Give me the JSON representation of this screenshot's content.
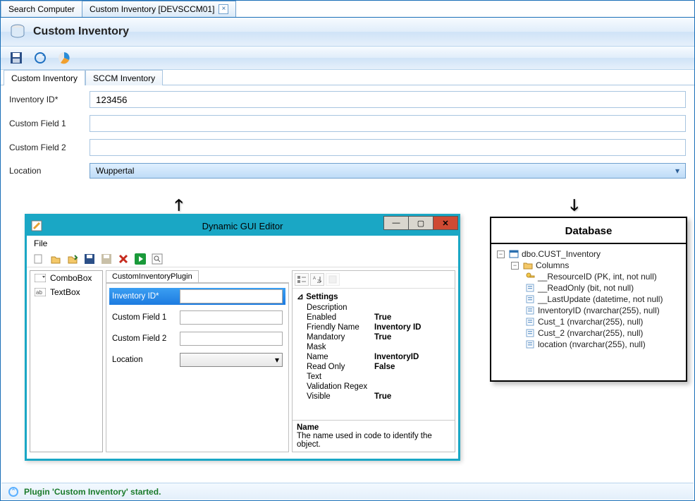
{
  "tabs": {
    "search": "Search Computer",
    "inventory": "Custom Inventory [DEVSCCM01]"
  },
  "header": {
    "title": "Custom Inventory"
  },
  "subtabs": {
    "custom": "Custom Inventory",
    "sccm": "SCCM Inventory"
  },
  "form": {
    "inventory_id_label": "Inventory ID*",
    "inventory_id_value": "123456",
    "custom1_label": "Custom Field 1",
    "custom1_value": "",
    "custom2_label": "Custom Field 2",
    "custom2_value": "",
    "location_label": "Location",
    "location_value": "Wuppertal"
  },
  "editor": {
    "title": "Dynamic GUI Editor",
    "menu_file": "File",
    "toolbox": {
      "combo": "ComboBox",
      "textbox": "TextBox"
    },
    "center_tab": "CustomInventoryPlugin",
    "fields": {
      "inventory_id": "Inventory ID*",
      "custom1": "Custom Field 1",
      "custom2": "Custom Field 2",
      "location": "Location"
    },
    "props_heading": "Settings",
    "props": {
      "Description": "",
      "Enabled": "True",
      "Friendly Name": "Inventory ID",
      "Mandatory": "True",
      "Mask": "",
      "Name": "InventoryID",
      "Read Only": "False",
      "Text": "",
      "Validation Regex": "",
      "Visible": "True"
    },
    "desc_title": "Name",
    "desc_text": "The name used in code to identify the object."
  },
  "database": {
    "title": "Database",
    "table": "dbo.CUST_Inventory",
    "columns_label": "Columns",
    "cols": [
      "__ResourceID (PK, int, not null)",
      "__ReadOnly (bit, not null)",
      "__LastUpdate (datetime, not null)",
      "InventoryID (nvarchar(255), null)",
      "Cust_1 (nvarchar(255), null)",
      "Cust_2 (nvarchar(255), null)",
      "location (nvarchar(255), null)"
    ]
  },
  "status": {
    "text": "Plugin 'Custom Inventory' started."
  }
}
